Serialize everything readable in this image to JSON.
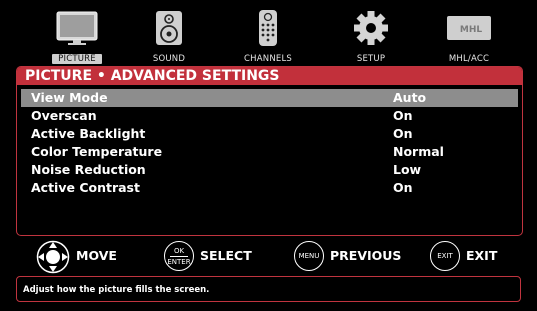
{
  "categories": [
    {
      "label": "PICTURE",
      "icon": "tv-icon",
      "active": true
    },
    {
      "label": "SOUND",
      "icon": "speaker-icon",
      "active": false
    },
    {
      "label": "CHANNELS",
      "icon": "remote-icon",
      "active": false
    },
    {
      "label": "SETUP",
      "icon": "gear-icon",
      "active": false
    },
    {
      "label": "MHL/ACC",
      "icon": "mhl-icon",
      "active": false
    }
  ],
  "mhl_logo_text": "MHL",
  "panel": {
    "title": "PICTURE • ADVANCED SETTINGS",
    "settings": [
      {
        "name": "View Mode",
        "value": "Auto"
      },
      {
        "name": "Overscan",
        "value": "On"
      },
      {
        "name": "Active Backlight",
        "value": "On"
      },
      {
        "name": "Color Temperature",
        "value": "Normal"
      },
      {
        "name": "Noise Reduction",
        "value": "Low"
      },
      {
        "name": "Active Contrast",
        "value": "On"
      }
    ]
  },
  "legend": {
    "move": "MOVE",
    "ok_top": "OK",
    "ok_bottom": "ENTER",
    "select": "SELECT",
    "menu_key": "MENU",
    "previous": "PREVIOUS",
    "exit_key": "EXIT",
    "exit": "EXIT"
  },
  "help_text": "Adjust how the picture fills the screen.",
  "colors": {
    "accent": "#c2303b",
    "selected_row": "#8d8d8d",
    "background": "#000000"
  }
}
